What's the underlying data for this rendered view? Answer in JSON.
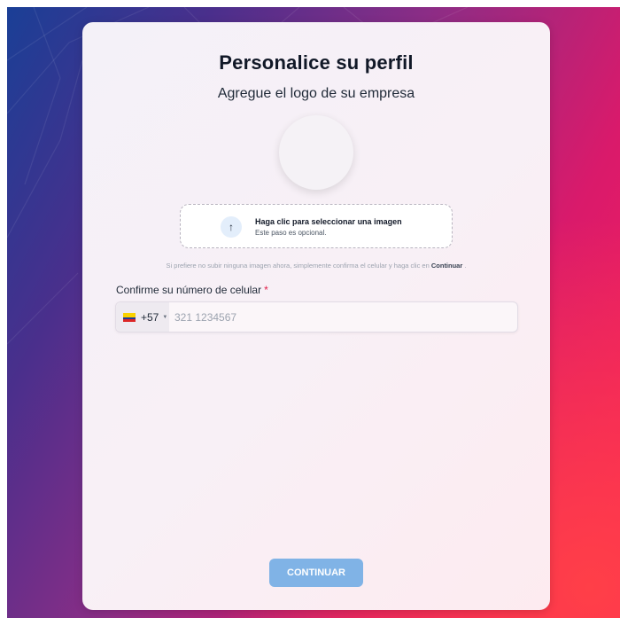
{
  "profile": {
    "title": "Personalice su perfil",
    "subtitle": "Agregue el logo de su empresa"
  },
  "upload": {
    "icon": "upload-arrow-icon",
    "icon_glyph": "↑",
    "title": "Haga clic para seleccionar una imagen",
    "subtitle": "Este paso es opcional."
  },
  "hint": {
    "text": "Si prefiere no subir ninguna imagen ahora, simplemente confirma el celular y haga clic en ",
    "emphasis": "Continuar",
    "suffix": " ."
  },
  "phone": {
    "label": "Confirme su número de celular",
    "required_mark": "*",
    "country_code": "+57",
    "country_flag": "colombia-flag-icon",
    "caret": "▼",
    "placeholder": "321 1234567"
  },
  "actions": {
    "continue_label": "CONTINUAR"
  },
  "colors": {
    "accent_button": "#80b3e6",
    "required": "#e11d48"
  }
}
